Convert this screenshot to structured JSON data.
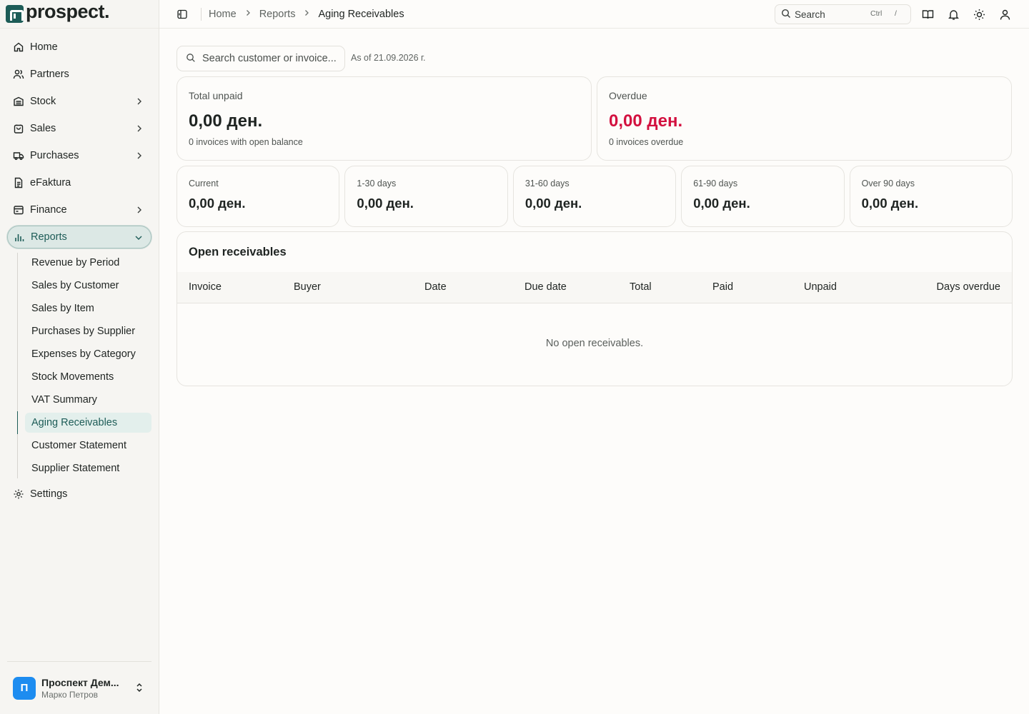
{
  "brand": {
    "name": "prospect."
  },
  "nav": {
    "items": [
      {
        "label": "Home",
        "icon": "home-icon"
      },
      {
        "label": "Partners",
        "icon": "partners-icon"
      },
      {
        "label": "Stock",
        "icon": "stock-icon"
      },
      {
        "label": "Sales",
        "icon": "sales-icon"
      },
      {
        "label": "Purchases",
        "icon": "purchases-icon"
      },
      {
        "label": "eFaktura",
        "icon": "document-icon"
      },
      {
        "label": "Finance",
        "icon": "finance-icon"
      },
      {
        "label": "Reports",
        "icon": "bar-chart-icon"
      },
      {
        "label": "Settings",
        "icon": "gear-icon"
      }
    ],
    "reports_sub": [
      "Revenue by Period",
      "Sales by Customer",
      "Sales by Item",
      "Purchases by Supplier",
      "Expenses by Category",
      "Stock Movements",
      "VAT Summary",
      "Aging Receivables",
      "Customer Statement",
      "Supplier Statement"
    ]
  },
  "user": {
    "avatar": "П",
    "name": "Проспект Дем...",
    "person": "Марко Петров"
  },
  "breadcrumb": [
    "Home",
    "Reports",
    "Aging Receivables"
  ],
  "search": {
    "label": "Search",
    "kbd1": "Ctrl",
    "kbd2": "/"
  },
  "filter": {
    "placeholder": "Search customer or invoice...",
    "as_of": "As of 21.09.2026 г."
  },
  "summary": {
    "total": {
      "title": "Total unpaid",
      "value": "0,00 ден.",
      "sub": "0 invoices with open balance"
    },
    "overdue": {
      "title": "Overdue",
      "value": "0,00 ден.",
      "sub": "0 invoices overdue",
      "color": "#d3103f"
    }
  },
  "buckets": [
    {
      "title": "Current",
      "value": "0,00 ден."
    },
    {
      "title": "1-30 days",
      "value": "0,00 ден."
    },
    {
      "title": "31-60 days",
      "value": "0,00 ден."
    },
    {
      "title": "61-90 days",
      "value": "0,00 ден."
    },
    {
      "title": "Over 90 days",
      "value": "0,00 ден."
    }
  ],
  "table": {
    "title": "Open receivables",
    "columns": [
      "Invoice",
      "Buyer",
      "Date",
      "Due date",
      "Total",
      "Paid",
      "Unpaid",
      "Days overdue"
    ],
    "empty": "No open receivables."
  },
  "colors": {
    "accent": "#1d5c57",
    "danger": "#d3103f",
    "avatar": "#1d8cf0"
  }
}
